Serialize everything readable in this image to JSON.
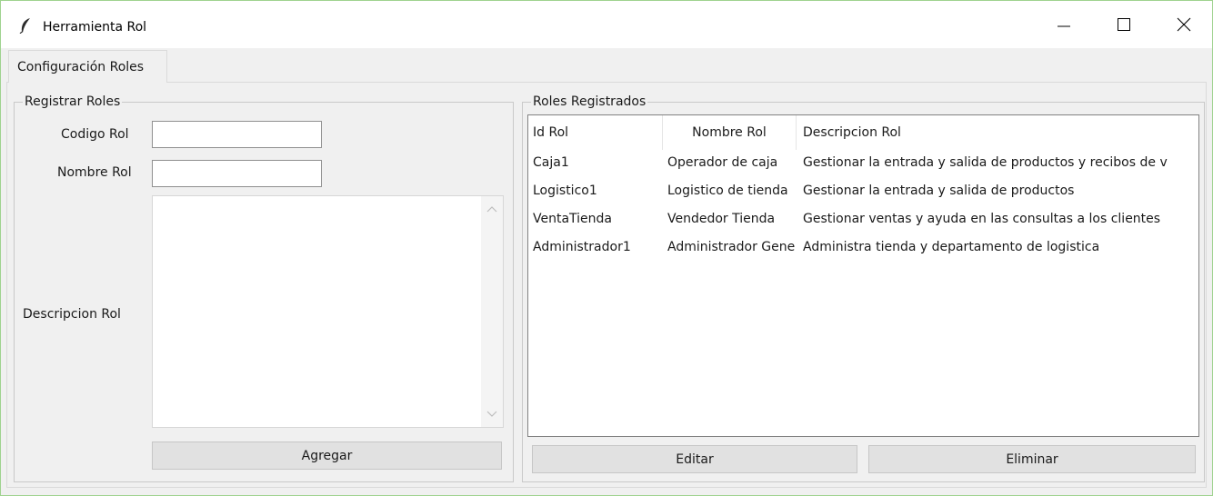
{
  "window": {
    "title": "Herramienta Rol",
    "icon": "feather-icon",
    "controls": {
      "minimize": "minimize-icon",
      "maximize": "maximize-icon",
      "close": "close-icon"
    }
  },
  "tabs": [
    {
      "label": "Configuración Roles"
    }
  ],
  "register": {
    "group_title": "Registrar Roles",
    "code_label": "Codigo Rol",
    "code_value": "",
    "name_label": "Nombre Rol",
    "name_value": "",
    "description_label": "Descripcion Rol",
    "description_value": "",
    "add_button": "Agregar"
  },
  "registered": {
    "group_title": "Roles Registrados",
    "columns": [
      "Id Rol",
      "Nombre Rol",
      "Descripcion Rol"
    ],
    "rows": [
      [
        "Caja1",
        "Operador de caja",
        "Gestionar la entrada y salida de productos y recibos de v"
      ],
      [
        "Logistico1",
        "Logistico de tienda",
        "Gestionar la entrada y salida de productos"
      ],
      [
        "VentaTienda",
        "Vendedor Tienda",
        "Gestionar ventas y ayuda en las consultas a los clientes"
      ],
      [
        "Administrador1",
        "Administrador General",
        "Administra tienda y departamento de logistica"
      ]
    ],
    "edit_button": "Editar",
    "delete_button": "Eliminar"
  },
  "colors": {
    "window_border": "#9fd38f",
    "background": "#f0f0f0",
    "button": "#e1e1e1"
  }
}
